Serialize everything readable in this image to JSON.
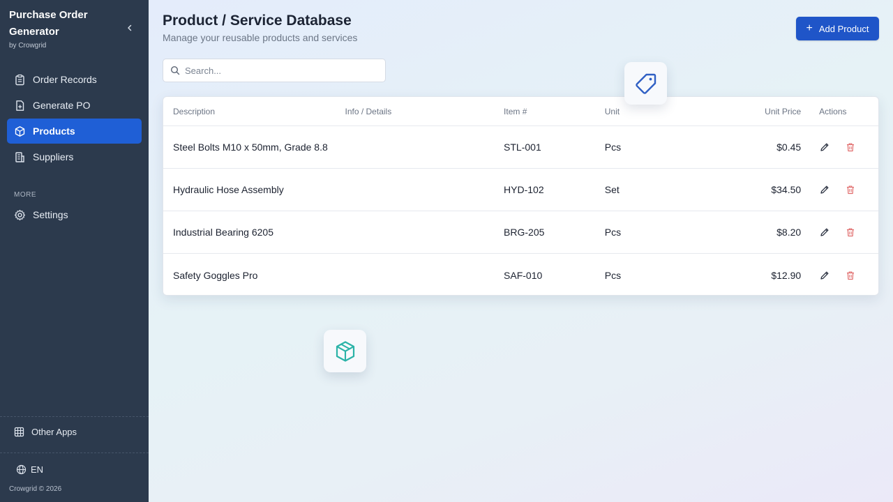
{
  "sidebar": {
    "title": "Purchase Order Generator",
    "subtitle": "by Crowgrid",
    "nav": [
      {
        "label": "Order Records",
        "icon": "clipboard-icon"
      },
      {
        "label": "Generate PO",
        "icon": "file-plus-icon"
      },
      {
        "label": "Products",
        "icon": "box-icon",
        "active": true
      },
      {
        "label": "Suppliers",
        "icon": "building-icon"
      }
    ],
    "section_label": "MORE",
    "settings_label": "Settings",
    "other_apps_label": "Other Apps",
    "language": "EN",
    "copyright": "Crowgrid © 2026"
  },
  "header": {
    "title": "Product / Service Database",
    "subtitle": "Manage your reusable products and services",
    "add_button": "Add Product"
  },
  "search": {
    "placeholder": "Search..."
  },
  "table": {
    "columns": {
      "description": "Description",
      "info": "Info / Details",
      "item": "Item #",
      "unit": "Unit",
      "price": "Unit Price",
      "actions": "Actions"
    },
    "rows": [
      {
        "description": "Steel Bolts M10 x 50mm, Grade 8.8",
        "info": "",
        "item": "STL-001",
        "unit": "Pcs",
        "price": "$0.45"
      },
      {
        "description": "Hydraulic Hose Assembly",
        "info": "",
        "item": "HYD-102",
        "unit": "Set",
        "price": "$34.50"
      },
      {
        "description": "Industrial Bearing 6205",
        "info": "",
        "item": "BRG-205",
        "unit": "Pcs",
        "price": "$8.20"
      },
      {
        "description": "Safety Goggles Pro",
        "info": "",
        "item": "SAF-010",
        "unit": "Pcs",
        "price": "$12.90"
      }
    ]
  },
  "colors": {
    "sidebar_bg": "#2c3a4d",
    "accent": "#1f55c8",
    "active_nav": "#1f5fd6",
    "delete": "#e06b6b",
    "tag_icon": "#2f5fc4",
    "box_icon": "#2bb3a7"
  }
}
